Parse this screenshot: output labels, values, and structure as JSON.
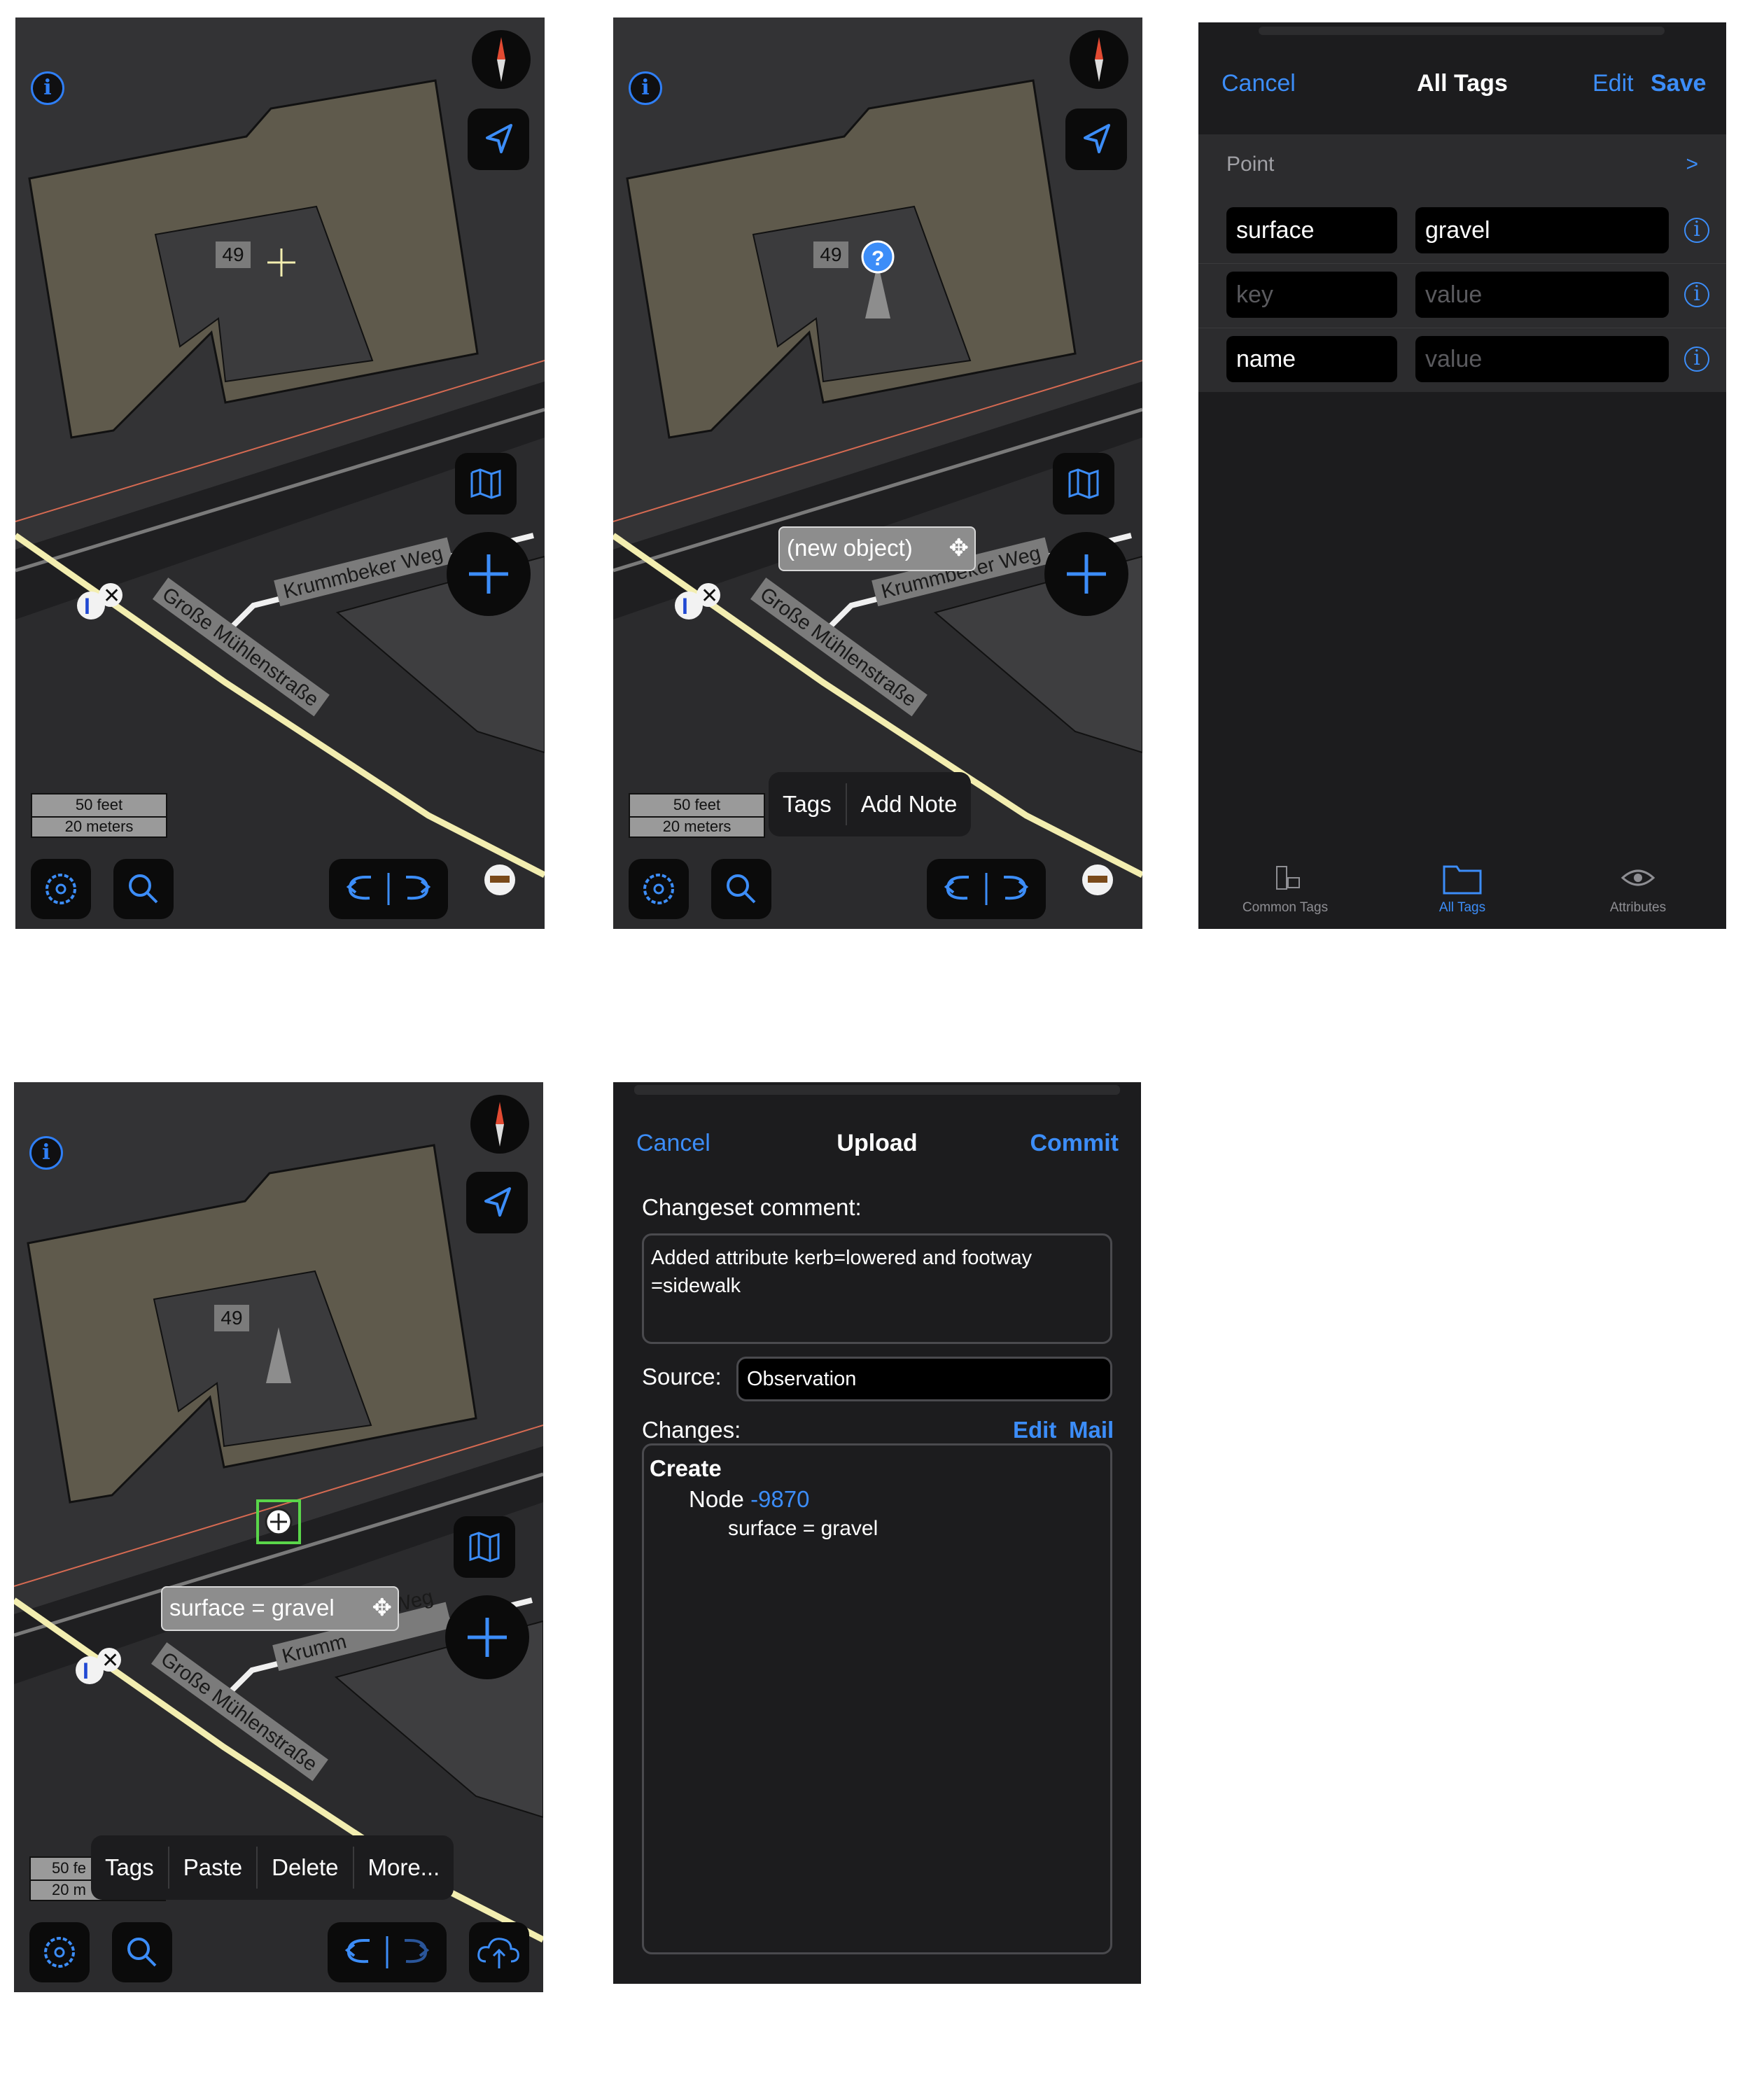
{
  "map": {
    "building_number": "49",
    "street_1": "Krummbeker Weg",
    "street_2": "Große Mühlenstraße",
    "scale_feet": "50 feet",
    "scale_meters": "20 meters",
    "scale_feet_partial": "50 fe",
    "scale_meters_partial": "20 m"
  },
  "screen2": {
    "new_object_label": "(new object)",
    "popup": [
      "Tags",
      "Add Note"
    ]
  },
  "screen3": {
    "cancel": "Cancel",
    "title": "All Tags",
    "edit": "Edit",
    "save": "Save",
    "type_label": "Point",
    "type_arrow": ">",
    "tags": [
      {
        "key": "surface",
        "value": "gravel",
        "key_placeholder": false,
        "value_placeholder": false
      },
      {
        "key": "key",
        "value": "value",
        "key_placeholder": true,
        "value_placeholder": true
      },
      {
        "key": "name",
        "value": "value",
        "key_placeholder": false,
        "value_placeholder": true
      }
    ],
    "tabs": [
      "Common Tags",
      "All Tags",
      "Attributes"
    ]
  },
  "screen4": {
    "object_label": "surface = gravel",
    "street_partial_1": "Weg",
    "street_partial_2": "Krumm",
    "popup": [
      "Tags",
      "Paste",
      "Delete",
      "More..."
    ]
  },
  "screen5": {
    "cancel": "Cancel",
    "title": "Upload",
    "commit": "Commit",
    "comment_label": "Changeset comment:",
    "comment_line1": "Added attribute kerb=lowered and footway",
    "comment_line2": "=sidewalk",
    "source_label": "Source:",
    "source_value": "Observation",
    "changes_label": "Changes:",
    "edit": "Edit",
    "mail": "Mail",
    "create": "Create",
    "node_label": "Node",
    "node_id": "-9870",
    "tag_line": "surface = gravel"
  },
  "colors": {
    "accent": "#3c8df8",
    "building": "#5f5a4c",
    "road": "#f3eeb0",
    "footway": "#f0f0f0"
  }
}
